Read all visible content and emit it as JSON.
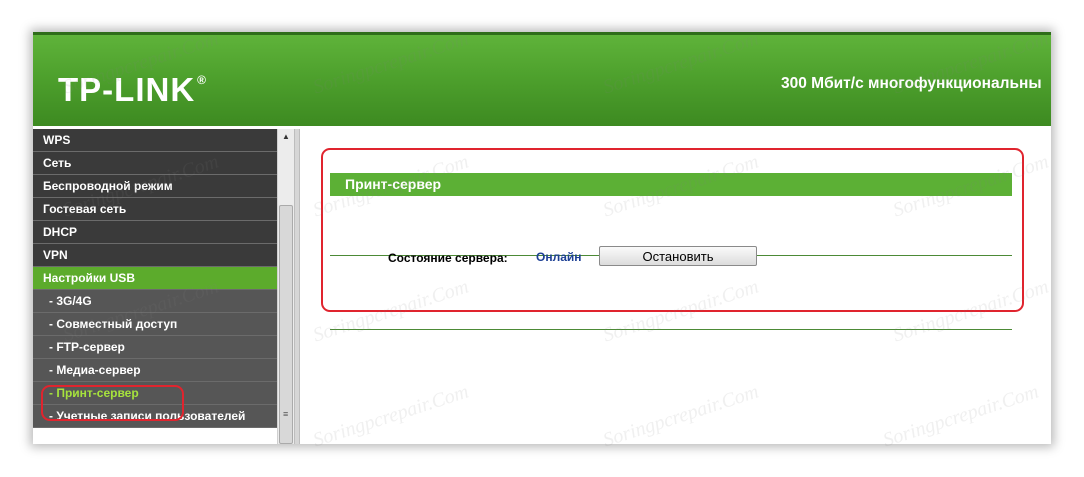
{
  "header": {
    "logo_text": "TP-LINK",
    "logo_reg": "®",
    "title": "300 Мбит/с многофункциональны"
  },
  "sidebar": {
    "items": [
      {
        "label": "WPS",
        "type": "item"
      },
      {
        "label": "Сеть",
        "type": "item"
      },
      {
        "label": "Беспроводной режим",
        "type": "item"
      },
      {
        "label": "Гостевая сеть",
        "type": "item"
      },
      {
        "label": "DHCP",
        "type": "item"
      },
      {
        "label": "VPN",
        "type": "item"
      },
      {
        "label": "Настройки USB",
        "type": "active"
      },
      {
        "label": "- 3G/4G",
        "type": "sub"
      },
      {
        "label": "- Совместный доступ",
        "type": "sub"
      },
      {
        "label": "- FTP-сервер",
        "type": "sub"
      },
      {
        "label": "- Медиа-сервер",
        "type": "sub"
      },
      {
        "label": "- Принт-сервер",
        "type": "sub-current"
      },
      {
        "label": "- Учетные записи пользователей",
        "type": "sub"
      }
    ]
  },
  "main": {
    "section_title": "Принт-сервер",
    "status_label": "Состояние сервера:",
    "status_value": "Онлайн",
    "stop_button": "Остановить"
  },
  "watermark": "Soringpcrepair.Com",
  "colors": {
    "brand_green": "#5cb035",
    "highlight_red": "#e0242e",
    "status_blue": "#1c3f94",
    "current_item": "#a6e23d"
  }
}
